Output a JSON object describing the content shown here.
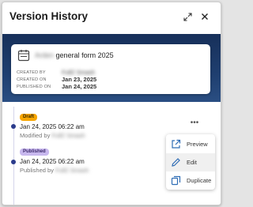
{
  "header": {
    "title": "Version History",
    "expand_icon": "expand-icon",
    "close_icon": "close-icon"
  },
  "document": {
    "icon": "calendar-document-icon",
    "title_redacted": "Arden",
    "title": "general form 2025",
    "created_by_label": "CREATED BY",
    "created_by_value": "FullZ Smash",
    "created_on_label": "CREATED ON",
    "created_on_value": "Jan 23, 2025",
    "published_on_label": "PUBLISHED ON",
    "published_on_value": "Jan 24, 2025"
  },
  "versions": [
    {
      "badge": "Draft",
      "date": "Jan 24, 2025 06:22 am",
      "by_prefix": "Modified by",
      "by_name": "FullZ Smash"
    },
    {
      "badge": "Published",
      "date": "Jan 24, 2025 06:22 am",
      "by_prefix": "Published by",
      "by_name": "FullZ Smash"
    }
  ],
  "menu": {
    "kebab": "•••",
    "items": [
      {
        "label": "Preview",
        "icon": "open-external-icon"
      },
      {
        "label": "Edit",
        "icon": "pencil-icon"
      },
      {
        "label": "Duplicate",
        "icon": "duplicate-icon"
      }
    ]
  },
  "colors": {
    "band": "#1f3f70",
    "draft": "#f7a600",
    "published": "#c8b8ee",
    "menu_icon": "#2f6db5"
  }
}
